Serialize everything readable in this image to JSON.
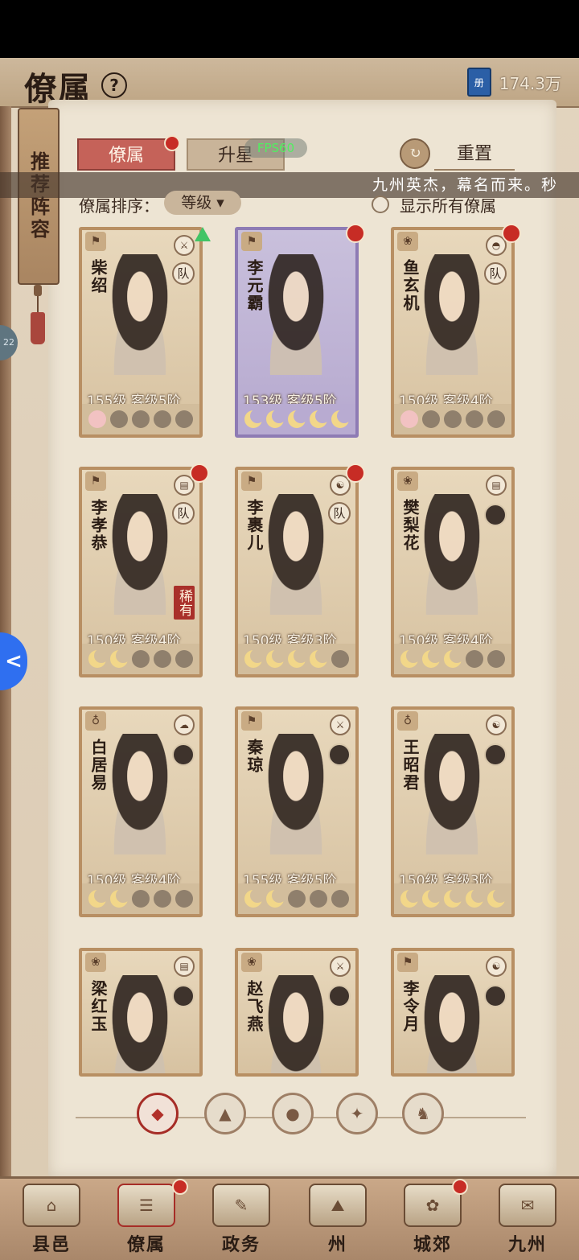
{
  "header": {
    "title": "僚属",
    "help_icon": "?",
    "currency_value": "174.3万",
    "currency_icon": "book-icon"
  },
  "side": {
    "banner_text": "推荐阵容",
    "tab_badge": "22"
  },
  "tabs": [
    {
      "label": "僚属",
      "active": true
    },
    {
      "label": "升星",
      "active": false
    }
  ],
  "fps": "FPS60",
  "reset_label": "重置",
  "ticker": "九州英杰，幕名而来。秒",
  "sort": {
    "label": "僚属排序：",
    "value": "等级 ▾"
  },
  "show_all_label": "显示所有僚属",
  "cards": [
    {
      "name": "柴绍",
      "level": "155级 客级5阶",
      "moons": [
        "pink",
        "off",
        "off",
        "off",
        "off"
      ],
      "team": "队"
    },
    {
      "name": "李元霸",
      "level": "153级 客级5阶",
      "moons": [
        "on",
        "on",
        "on",
        "on",
        "on"
      ]
    },
    {
      "name": "鱼玄机",
      "level": "150级 客级4阶",
      "moons": [
        "pink",
        "off",
        "off",
        "off",
        "off"
      ],
      "team": "队"
    },
    {
      "name": "李孝恭",
      "level": "150级 客级4阶",
      "moons": [
        "on",
        "on",
        "off",
        "off",
        "off"
      ],
      "team": "队",
      "rare": "稀有"
    },
    {
      "name": "李裹儿",
      "level": "150级 客级3阶",
      "moons": [
        "on",
        "on",
        "on",
        "on",
        "off"
      ],
      "team": "队"
    },
    {
      "name": "樊梨花",
      "level": "150级 客级4阶",
      "moons": [
        "on",
        "on",
        "on",
        "off",
        "off"
      ]
    },
    {
      "name": "白居易",
      "level": "150级 客级4阶",
      "moons": [
        "on",
        "on",
        "off",
        "off",
        "off"
      ]
    },
    {
      "name": "秦琼",
      "level": "155级 客级5阶",
      "moons": [
        "on",
        "on",
        "off",
        "off",
        "off"
      ]
    },
    {
      "name": "王昭君",
      "level": "150级 客级3阶",
      "moons": [
        "on",
        "on",
        "on",
        "on",
        "on"
      ]
    },
    {
      "name": "梁红玉",
      "level": "",
      "moons": []
    },
    {
      "name": "赵飞燕",
      "level": "",
      "moons": []
    },
    {
      "name": "李令月",
      "level": "",
      "moons": []
    }
  ],
  "filters": [
    "◆",
    "▲",
    "●",
    "✦",
    "♞"
  ],
  "nav": [
    {
      "label": "县邑",
      "icon": "city-gate-icon",
      "glyph": "⌂"
    },
    {
      "label": "僚属",
      "icon": "scroll-figure-icon",
      "glyph": "☰"
    },
    {
      "label": "政务",
      "icon": "documents-icon",
      "glyph": "✎"
    },
    {
      "label": "州",
      "icon": "mountain-icon",
      "glyph": "⛰"
    },
    {
      "label": "城郊",
      "icon": "village-icon",
      "glyph": "✿"
    },
    {
      "label": "九州",
      "icon": "map-scroll-icon",
      "glyph": "✉"
    }
  ]
}
